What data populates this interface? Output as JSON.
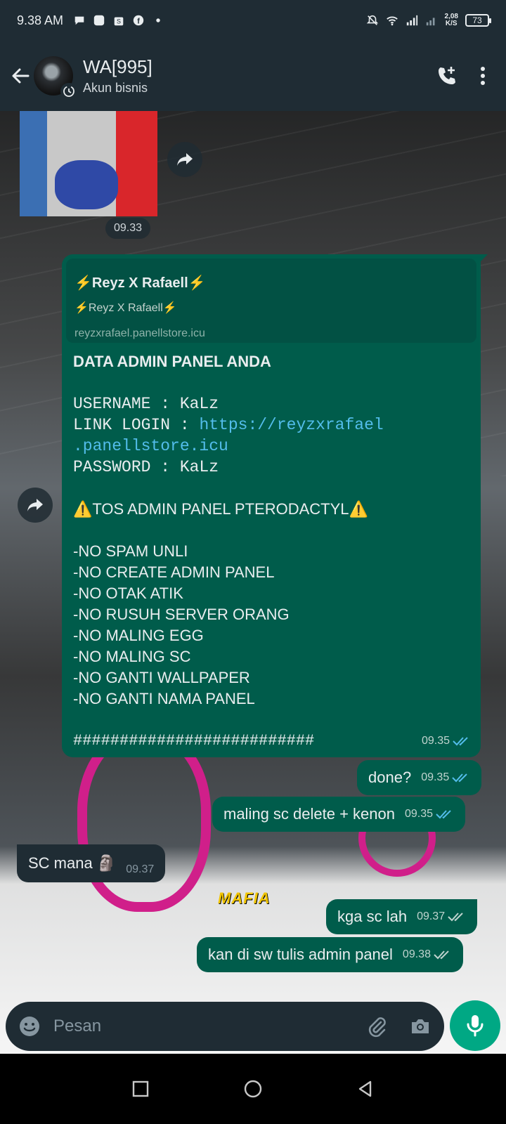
{
  "status_bar": {
    "time": "9.38 AM",
    "net_speed_value": "2,08",
    "net_speed_unit": "K/S",
    "battery": "73"
  },
  "header": {
    "contact_name": "WA[995]",
    "subtitle": "Akun bisnis"
  },
  "chat": {
    "image_time": "09.33",
    "messages": [
      {
        "link_preview": {
          "title": "⚡Reyz X Rafaell⚡",
          "description": "⚡Reyz X Rafaell⚡",
          "url": "reyzxrafael.panellstore.icu"
        },
        "heading": "DATA ADMIN PANEL ANDA",
        "username_line": "USERNAME : KaLz",
        "link_label": "LINK LOGIN : ",
        "link_url_1": "https://reyzxrafael",
        "link_url_2": ".panellstore.icu",
        "password_line": "PASSWORD : KaLz",
        "tos_heading": "⚠️TOS ADMIN PANEL PTERODACTYL⚠️",
        "rules": [
          "-NO SPAM UNLI",
          "-NO CREATE ADMIN PANEL",
          "-NO OTAK ATIK",
          "-NO RUSUH SERVER ORANG",
          "-NO MALING EGG",
          "-NO MALING SC",
          "-NO GANTI WALLPAPER",
          "-NO GANTI NAMA PANEL"
        ],
        "hashes": "##########################",
        "time": "09.35"
      },
      {
        "text": "done?",
        "time": "09.35"
      },
      {
        "text": "maling sc delete + kenon",
        "time": "09.35"
      },
      {
        "text": "SC mana 🗿",
        "time": "09.37"
      },
      {
        "text": "kga sc lah",
        "time": "09.37"
      },
      {
        "text": "kan di sw tulis admin panel",
        "time": "09.38"
      }
    ],
    "wallpaper_text": "MAFIA"
  },
  "composer": {
    "placeholder": "Pesan"
  },
  "colors": {
    "outgoing_bubble": "#005c4b",
    "incoming_bubble": "#1f2c34",
    "accent": "#00a884",
    "read_tick": "#53bdeb",
    "header_bg": "#1f2c34"
  }
}
